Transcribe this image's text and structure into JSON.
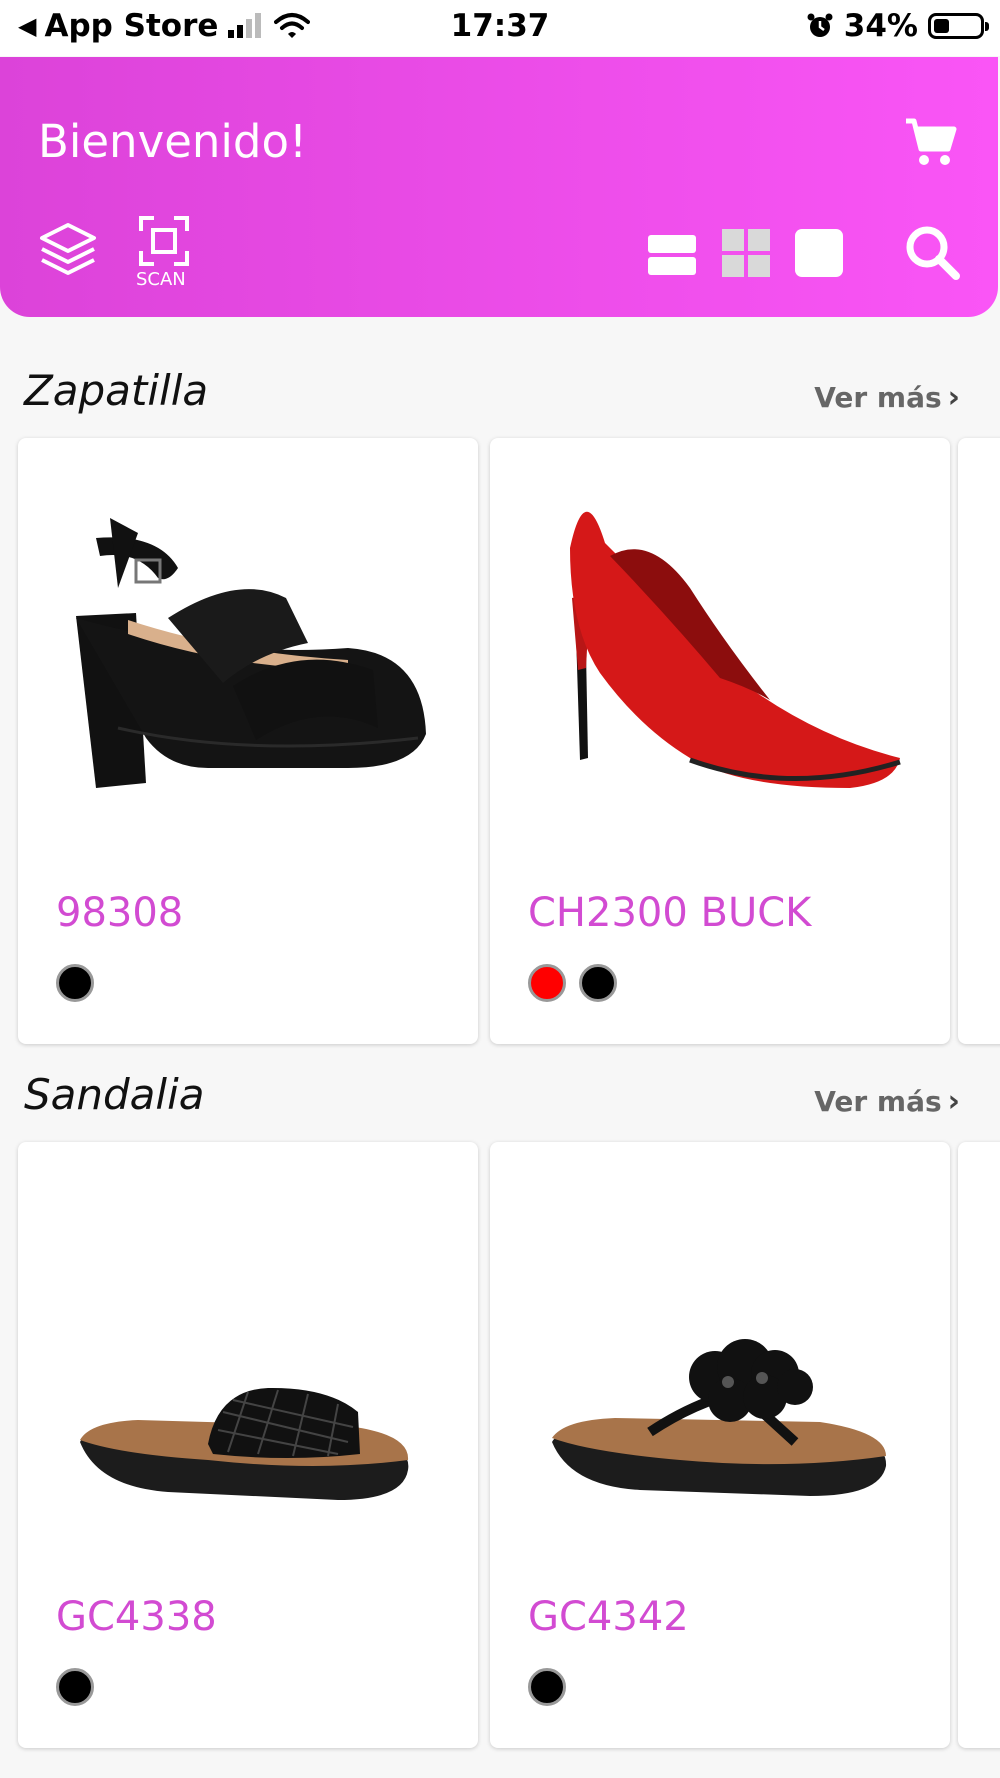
{
  "status_bar": {
    "back_app": "App Store",
    "time": "17:37",
    "battery": "34%",
    "battery_level": 0.34
  },
  "header": {
    "title": "Bienvenido!",
    "scan_label": "SCAN",
    "colors": {
      "gradient_start": "#dc43d9",
      "gradient_end": "#fa55f6"
    }
  },
  "sections": [
    {
      "title": "Zapatilla",
      "more_label": "Ver más",
      "products": [
        {
          "name": "98308",
          "image": "black-platform-sandal",
          "colors": [
            "#000000"
          ]
        },
        {
          "name": "CH2300 BUCK",
          "image": "red-suede-pump",
          "colors": [
            "#ff0000",
            "#000000"
          ]
        }
      ]
    },
    {
      "title": "Sandalia",
      "more_label": "Ver más",
      "products": [
        {
          "name": "GC4338",
          "image": "black-woven-slide",
          "colors": [
            "#000000"
          ]
        },
        {
          "name": "GC4342",
          "image": "black-flower-flip-flop",
          "colors": [
            "#000000"
          ]
        }
      ]
    }
  ],
  "accent_color": "#d24bd2"
}
